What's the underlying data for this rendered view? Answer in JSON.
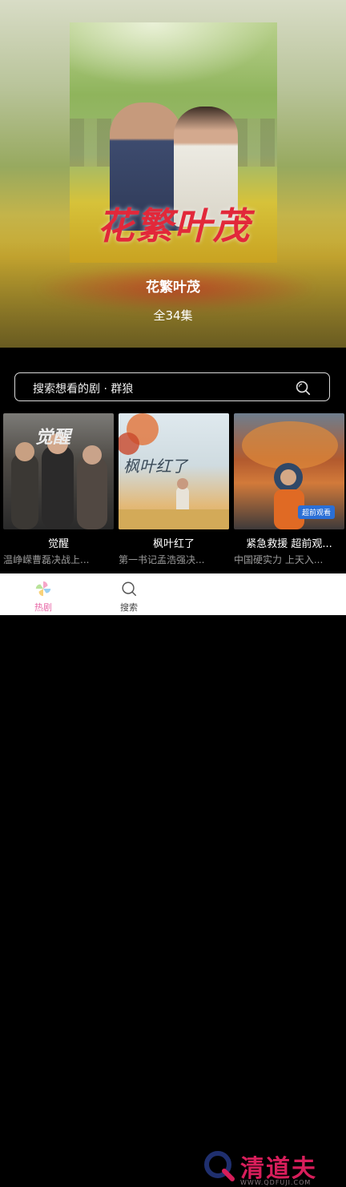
{
  "hero": {
    "poster_title": "花繁叶茂",
    "title": "花繁叶茂",
    "episodes": "全34集"
  },
  "search": {
    "placeholder": "搜索想看的剧 · 群狼"
  },
  "cards": [
    {
      "poster_art": "觉醒",
      "name": "觉醒",
      "desc": "温峥嵘曹磊决战上..."
    },
    {
      "poster_art": "枫叶红了",
      "name": "枫叶红了",
      "desc": "第一书记孟浩强决..."
    },
    {
      "poster_art": "超前观看",
      "name": "紧急救援 超前观...",
      "desc": "中国硬实力 上天入..."
    }
  ],
  "tabbar": {
    "items": [
      {
        "label": "热剧",
        "icon": "pinwheel-icon",
        "active": true
      },
      {
        "label": "搜索",
        "icon": "search-tab-icon",
        "active": false
      }
    ]
  },
  "watermark": {
    "brand": "清道夫",
    "url": "WWW.QDFUJI.COM"
  },
  "colors": {
    "accent_pink": "#e86aa8",
    "watermark_red": "#d81e5b",
    "poster_title_red": "#e2283a"
  }
}
